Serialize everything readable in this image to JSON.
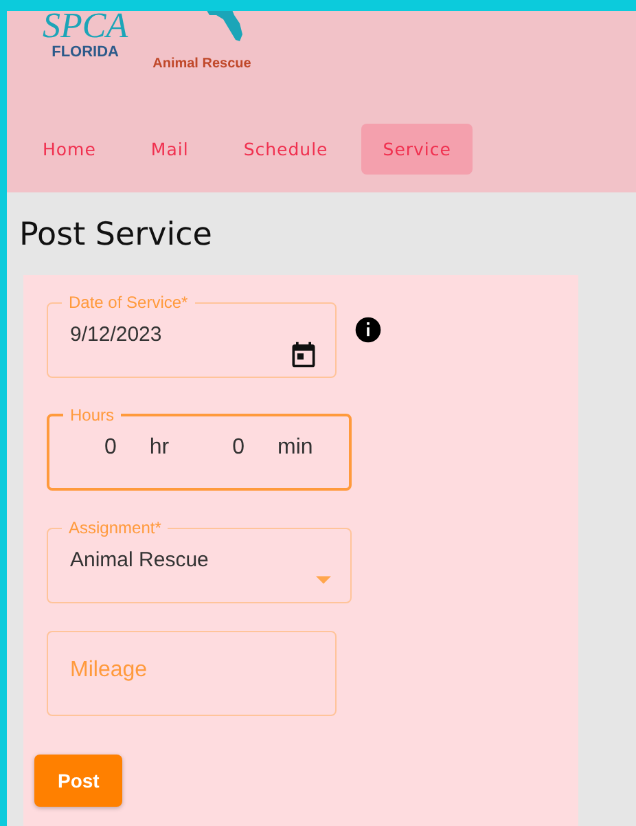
{
  "header": {
    "logos": [
      {
        "kind": "spca",
        "mark": "SPCA",
        "caption": "FLORIDA"
      },
      {
        "kind": "state",
        "caption": "Animal Rescue"
      }
    ],
    "tabs": [
      {
        "label": "Home",
        "selected": false
      },
      {
        "label": "Mail",
        "selected": false
      },
      {
        "label": "Schedule",
        "selected": false
      },
      {
        "label": "Service",
        "selected": true
      }
    ]
  },
  "page": {
    "title": "Post Service"
  },
  "form": {
    "date": {
      "label": "Date of Service*",
      "value": "9/12/2023"
    },
    "hours": {
      "label": "Hours",
      "focused": true,
      "hours_value": "0",
      "hours_unit": "hr",
      "minutes_value": "0",
      "minutes_unit": "min"
    },
    "assignment": {
      "label": "Assignment*",
      "value": "Animal Rescue"
    },
    "mileage": {
      "placeholder": "Mileage"
    },
    "submit": "Post"
  }
}
